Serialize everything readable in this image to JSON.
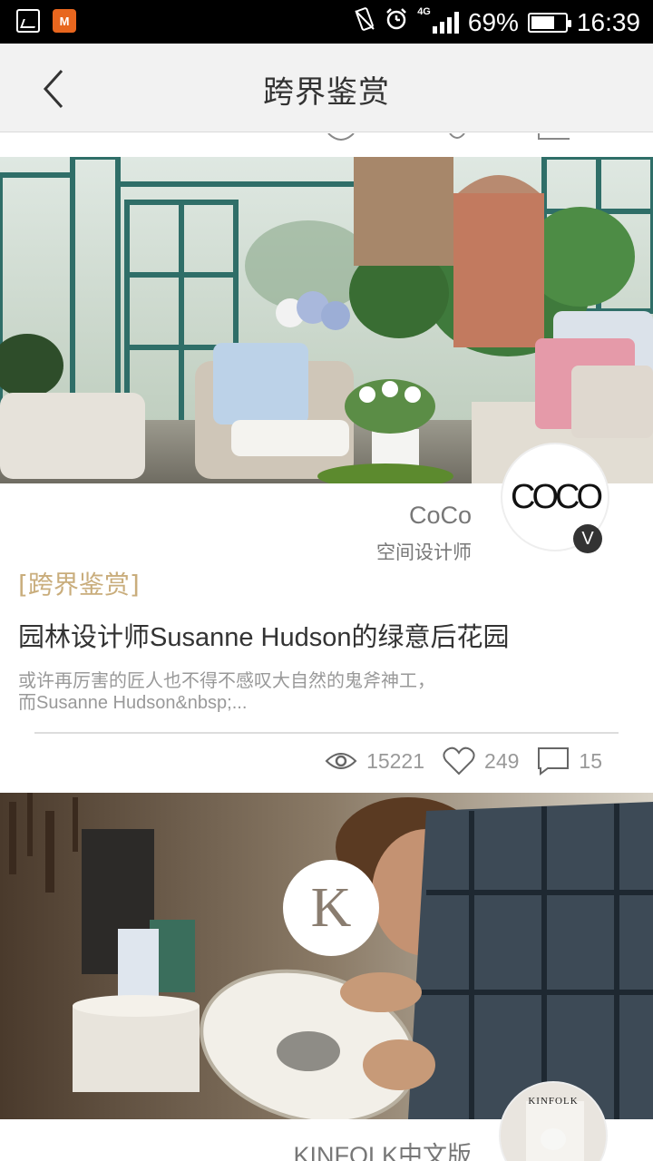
{
  "status_bar": {
    "network": "4G",
    "battery_percent": "69%",
    "battery_level": 0.69,
    "time": "16:39",
    "icons": [
      "gallery-icon",
      "app-notification-icon",
      "vibrate-icon",
      "alarm-icon",
      "signal-icon",
      "battery-icon"
    ]
  },
  "nav": {
    "title": "跨界鉴赏"
  },
  "articles": [
    {
      "author_name": "CoCo",
      "author_role": "空间设计师",
      "avatar_logo_text": "COCO",
      "verified_mark": "V",
      "category": "[跨界鉴赏]",
      "title": "园林设计师Susanne Hudson的绿意后花园",
      "excerpt_line1": "或许再厉害的匠人也不得不感叹大自然的鬼斧神工，",
      "excerpt_line2": "而Susanne Hudson&nbsp;...",
      "views": "15221",
      "likes": "249",
      "comments": "15"
    },
    {
      "author_name": "KINFOLK中文版",
      "logo_letter": "K",
      "avatar_text": "KINFOLK"
    }
  ],
  "colors": {
    "accent_category": "#c9ad7c",
    "nav_background": "#f2f2f2",
    "text_primary": "#333333",
    "text_secondary": "#999999"
  }
}
